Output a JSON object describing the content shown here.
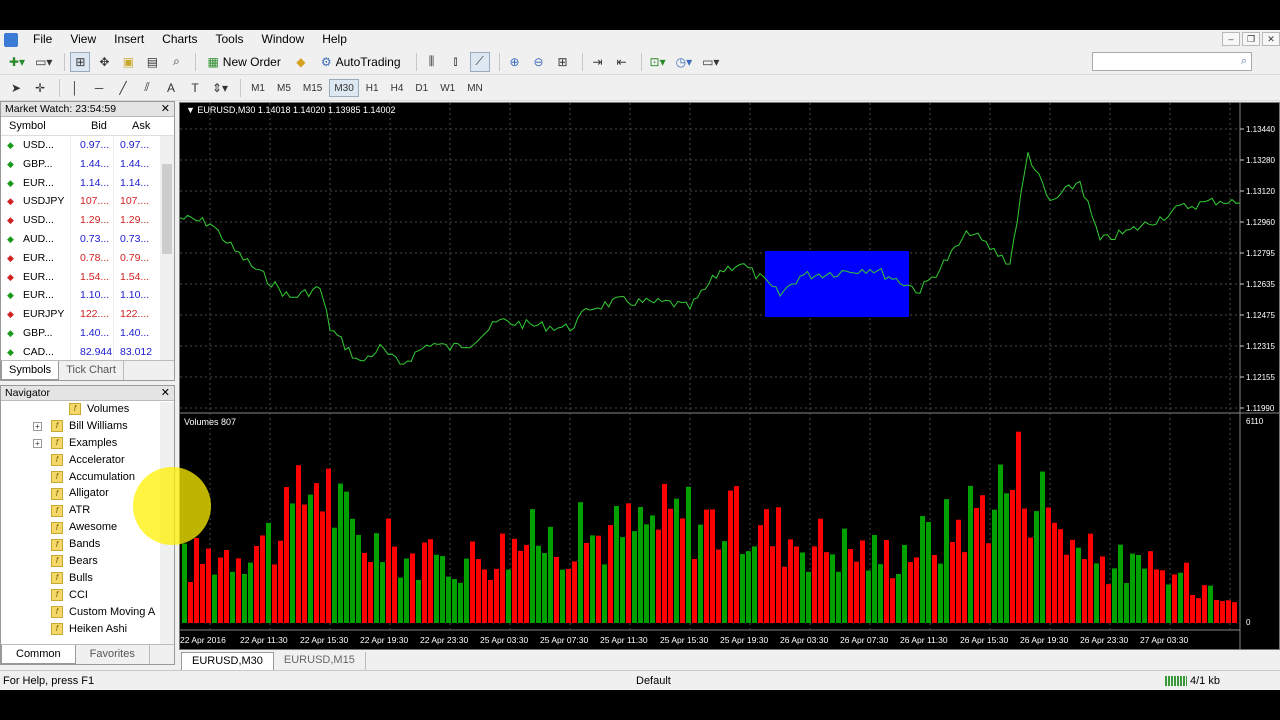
{
  "menu": [
    "File",
    "View",
    "Insert",
    "Charts",
    "Tools",
    "Window",
    "Help"
  ],
  "toolbar": {
    "new_order": "New Order",
    "autotrading": "AutoTrading"
  },
  "timeframes": [
    "M1",
    "M5",
    "M15",
    "M30",
    "H1",
    "H4",
    "D1",
    "W1",
    "MN"
  ],
  "active_timeframe": "M30",
  "market_watch": {
    "title": "Market Watch: 23:54:59",
    "columns": [
      "Symbol",
      "Bid",
      "Ask"
    ],
    "rows": [
      {
        "symbol": "USD...",
        "bid": "0.97...",
        "ask": "0.97...",
        "dir": "up"
      },
      {
        "symbol": "GBP...",
        "bid": "1.44...",
        "ask": "1.44...",
        "dir": "up"
      },
      {
        "symbol": "EUR...",
        "bid": "1.14...",
        "ask": "1.14...",
        "dir": "up"
      },
      {
        "symbol": "USDJPY",
        "bid": "107....",
        "ask": "107....",
        "dir": "down"
      },
      {
        "symbol": "USD...",
        "bid": "1.29...",
        "ask": "1.29...",
        "dir": "down"
      },
      {
        "symbol": "AUD...",
        "bid": "0.73...",
        "ask": "0.73...",
        "dir": "up"
      },
      {
        "symbol": "EUR...",
        "bid": "0.78...",
        "ask": "0.79...",
        "dir": "down"
      },
      {
        "symbol": "EUR...",
        "bid": "1.54...",
        "ask": "1.54...",
        "dir": "down"
      },
      {
        "symbol": "EUR...",
        "bid": "1.10...",
        "ask": "1.10...",
        "dir": "up"
      },
      {
        "symbol": "EURJPY",
        "bid": "122....",
        "ask": "122....",
        "dir": "down"
      },
      {
        "symbol": "GBP...",
        "bid": "1.40...",
        "ask": "1.40...",
        "dir": "up"
      },
      {
        "symbol": "CAD...",
        "bid": "82.944",
        "ask": "83.012",
        "dir": "up"
      }
    ],
    "tabs": [
      "Symbols",
      "Tick Chart"
    ]
  },
  "navigator": {
    "title": "Navigator",
    "items": [
      {
        "label": "Volumes",
        "indent": 2,
        "expand": false
      },
      {
        "label": "Bill Williams",
        "indent": 1,
        "expand": true
      },
      {
        "label": "Examples",
        "indent": 1,
        "expand": true
      },
      {
        "label": "Accelerator",
        "indent": 1,
        "expand": false
      },
      {
        "label": "Accumulation",
        "indent": 1,
        "expand": false
      },
      {
        "label": "Alligator",
        "indent": 1,
        "expand": false
      },
      {
        "label": "ATR",
        "indent": 1,
        "expand": false
      },
      {
        "label": "Awesome",
        "indent": 1,
        "expand": false
      },
      {
        "label": "Bands",
        "indent": 1,
        "expand": false
      },
      {
        "label": "Bears",
        "indent": 1,
        "expand": false
      },
      {
        "label": "Bulls",
        "indent": 1,
        "expand": false
      },
      {
        "label": "CCI",
        "indent": 1,
        "expand": false
      },
      {
        "label": "Custom Moving A",
        "indent": 1,
        "expand": false
      },
      {
        "label": "Heiken Ashi",
        "indent": 1,
        "expand": false
      }
    ],
    "tabs": [
      "Common",
      "Favorites"
    ]
  },
  "chart": {
    "title": "EURUSD,M30  1.14018 1.14020 1.13985 1.14002",
    "volume_title": "Volumes 807",
    "price_ticks": [
      "1.13440",
      "1.13280",
      "1.13120",
      "1.12960",
      "1.12795",
      "1.12635",
      "1.12475",
      "1.12315",
      "1.12155",
      "1.11990"
    ],
    "volume_ticks": [
      "6110",
      "0"
    ],
    "time_ticks": [
      "22 Apr 2016",
      "22 Apr 11:30",
      "22 Apr 15:30",
      "22 Apr 19:30",
      "22 Apr 23:30",
      "25 Apr 03:30",
      "25 Apr 07:30",
      "25 Apr 11:30",
      "25 Apr 15:30",
      "25 Apr 19:30",
      "26 Apr 03:30",
      "26 Apr 07:30",
      "26 Apr 11:30",
      "26 Apr 15:30",
      "26 Apr 19:30",
      "26 Apr 23:30",
      "27 Apr 03:30"
    ],
    "colors": {
      "line": "#32cd32",
      "up": "#00a000",
      "down": "#ff0000",
      "highlight": "#0000ff",
      "grid": "#4a4a4a"
    }
  },
  "chart_tabs": [
    "EURUSD,M30",
    "EURUSD,M15"
  ],
  "status": {
    "help": "For Help, press F1",
    "profile": "Default",
    "connection": "4/1 kb"
  }
}
